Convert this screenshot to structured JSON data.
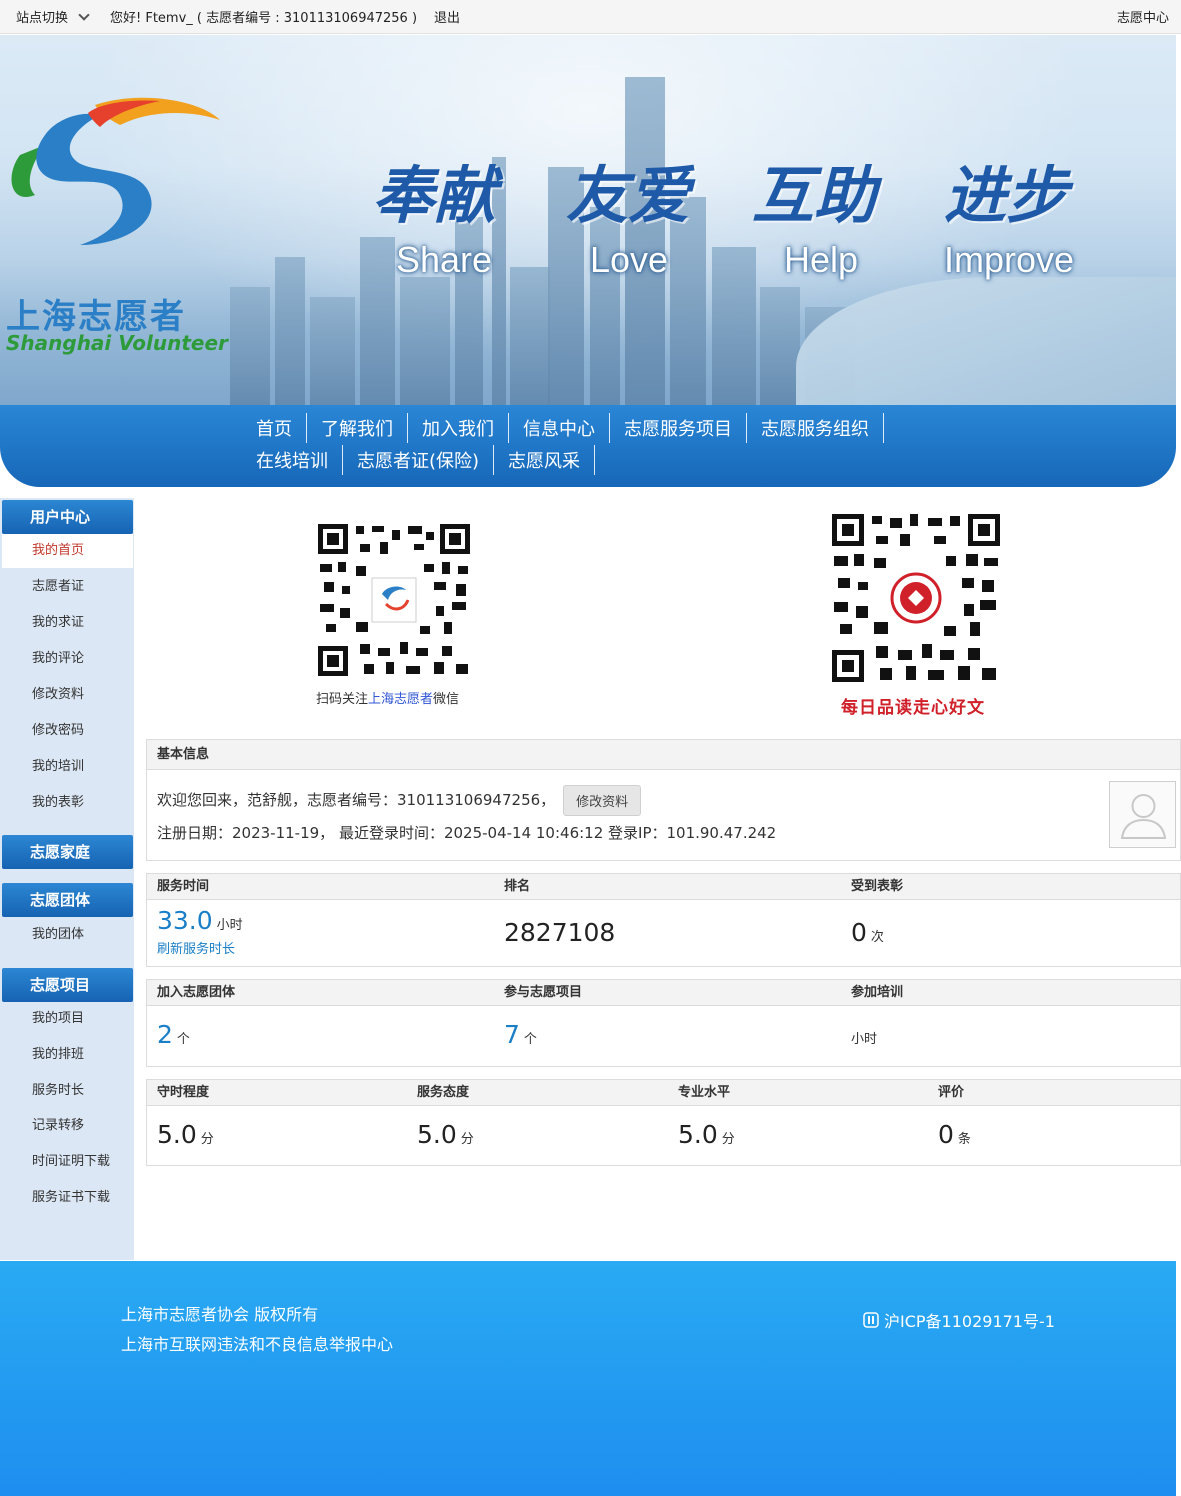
{
  "topbar": {
    "site_switch": "站点切换",
    "greeting": "您好! Ftemv_ ( 志愿者编号 : 310113106947256 )",
    "logout": "退出",
    "volunteer_center": "志愿中心"
  },
  "banner": {
    "logo_cn": "上海志愿者",
    "logo_en": "Shanghai Volunteer",
    "slogans": [
      {
        "cn": "奉献",
        "en": "Share"
      },
      {
        "cn": "友爱",
        "en": "Love"
      },
      {
        "cn": "互助",
        "en": "Help"
      },
      {
        "cn": "进步",
        "en": "Improve"
      }
    ]
  },
  "nav": {
    "row1": [
      "首页",
      "了解我们",
      "加入我们",
      "信息中心",
      "志愿服务项目",
      "志愿服务组织"
    ],
    "row2": [
      "在线培训",
      "志愿者证(保险)",
      "志愿风采"
    ]
  },
  "sidebar": {
    "user_center": "用户中心",
    "user_items": [
      "我的首页",
      "志愿者证",
      "我的求证",
      "我的评论",
      "修改资料",
      "修改密码",
      "我的培训",
      "我的表彰"
    ],
    "family": "志愿家庭",
    "group": "志愿团体",
    "group_items": [
      "我的团体"
    ],
    "project": "志愿项目",
    "project_items": [
      "我的项目",
      "我的排班",
      "服务时长",
      "记录转移",
      "时间证明下载",
      "服务证书下载"
    ]
  },
  "qr": {
    "left_caption_pre": "扫码关注",
    "left_caption_hl": "上海志愿者",
    "left_caption_post": "微信",
    "right_caption": "每日品读走心好文"
  },
  "basic": {
    "title": "基本信息",
    "welcome": "欢迎您回来，范舒舰，志愿者编号：310113106947256，",
    "edit_button": "修改资料",
    "register_line": "注册日期：2023-11-19，  最近登录时间：2025-04-14 10:46:12   登录IP：101.90.47.242"
  },
  "stats1": {
    "service_time_label": "服务时间",
    "service_time_value": "33.0",
    "service_time_unit": "小时",
    "refresh": "刷新服务时长",
    "rank_label": "排名",
    "rank_value": "2827108",
    "award_label": "受到表彰",
    "award_value": "0",
    "award_unit": "次"
  },
  "stats2": {
    "groups_label": "加入志愿团体",
    "groups_value": "2",
    "groups_unit": "个",
    "projects_label": "参与志愿项目",
    "projects_value": "7",
    "projects_unit": "个",
    "training_label": "参加培训",
    "training_unit": "小时"
  },
  "stats3": {
    "punctual_label": "守时程度",
    "punctual_value": "5.0",
    "attitude_label": "服务态度",
    "attitude_value": "5.0",
    "skill_label": "专业水平",
    "skill_value": "5.0",
    "review_label": "评价",
    "review_value": "0",
    "score_unit": "分",
    "review_unit": "条"
  },
  "footer": {
    "copyright": "上海市志愿者协会 版权所有",
    "report": "上海市互联网违法和不良信息举报中心",
    "icp": "沪ICP备11029171号-1"
  },
  "colors": {
    "nav_blue": "#1f78c9",
    "active_red": "#c0392b",
    "value_blue": "#1a7fc7",
    "footer_blue": "#24a0f1"
  }
}
